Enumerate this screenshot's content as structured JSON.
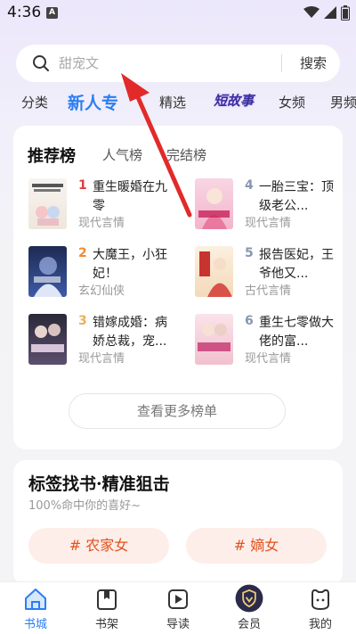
{
  "status": {
    "time": "4:36",
    "a_badge": "A"
  },
  "search": {
    "placeholder": "甜宠文",
    "button": "搜索"
  },
  "tabs": [
    {
      "label": "分类"
    },
    {
      "label": "新人专"
    },
    {
      "label": "精选"
    },
    {
      "label": "短故事"
    },
    {
      "label": "女频"
    },
    {
      "label": "男频"
    }
  ],
  "ranking": {
    "tabs": [
      "推荐榜",
      "人气榜",
      "完结榜"
    ],
    "books": [
      {
        "num": "1",
        "title": "重生暖婚在九零",
        "genre": "现代言情",
        "num_color": "#e23b3b"
      },
      {
        "num": "4",
        "title": "一胎三宝：顶级老公...",
        "genre": "现代言情",
        "num_color": "#8896b0"
      },
      {
        "num": "2",
        "title": "大魔王，小狂妃！",
        "genre": "玄幻仙侠",
        "num_color": "#f08b2d"
      },
      {
        "num": "5",
        "title": "报告医妃，王爷他又...",
        "genre": "古代言情",
        "num_color": "#8896b0"
      },
      {
        "num": "3",
        "title": "错嫁成婚：病娇总裁，宠...",
        "genre": "现代言情",
        "num_color": "#e8b05a"
      },
      {
        "num": "6",
        "title": "重生七零做大佬的富...",
        "genre": "现代言情",
        "num_color": "#8896b0"
      }
    ],
    "more": "查看更多榜单"
  },
  "tag_section": {
    "title": "标签找书·精准狙击",
    "subtitle": "100%命中你的喜好~",
    "chips": [
      "# 农家女",
      "# 嫡女"
    ]
  },
  "nav": [
    {
      "label": "书城",
      "icon": "home-icon",
      "active": true
    },
    {
      "label": "书架",
      "icon": "bookshelf-icon",
      "active": false
    },
    {
      "label": "导读",
      "icon": "play-guide-icon",
      "active": false
    },
    {
      "label": "会员",
      "icon": "vip-shield-icon",
      "active": false
    },
    {
      "label": "我的",
      "icon": "profile-icon",
      "active": false
    }
  ],
  "colors": {
    "accent": "#2b7ef2",
    "chip_text": "#e2531f",
    "chip_bg": "#fdeee9",
    "arrow": "#e22a2a"
  }
}
